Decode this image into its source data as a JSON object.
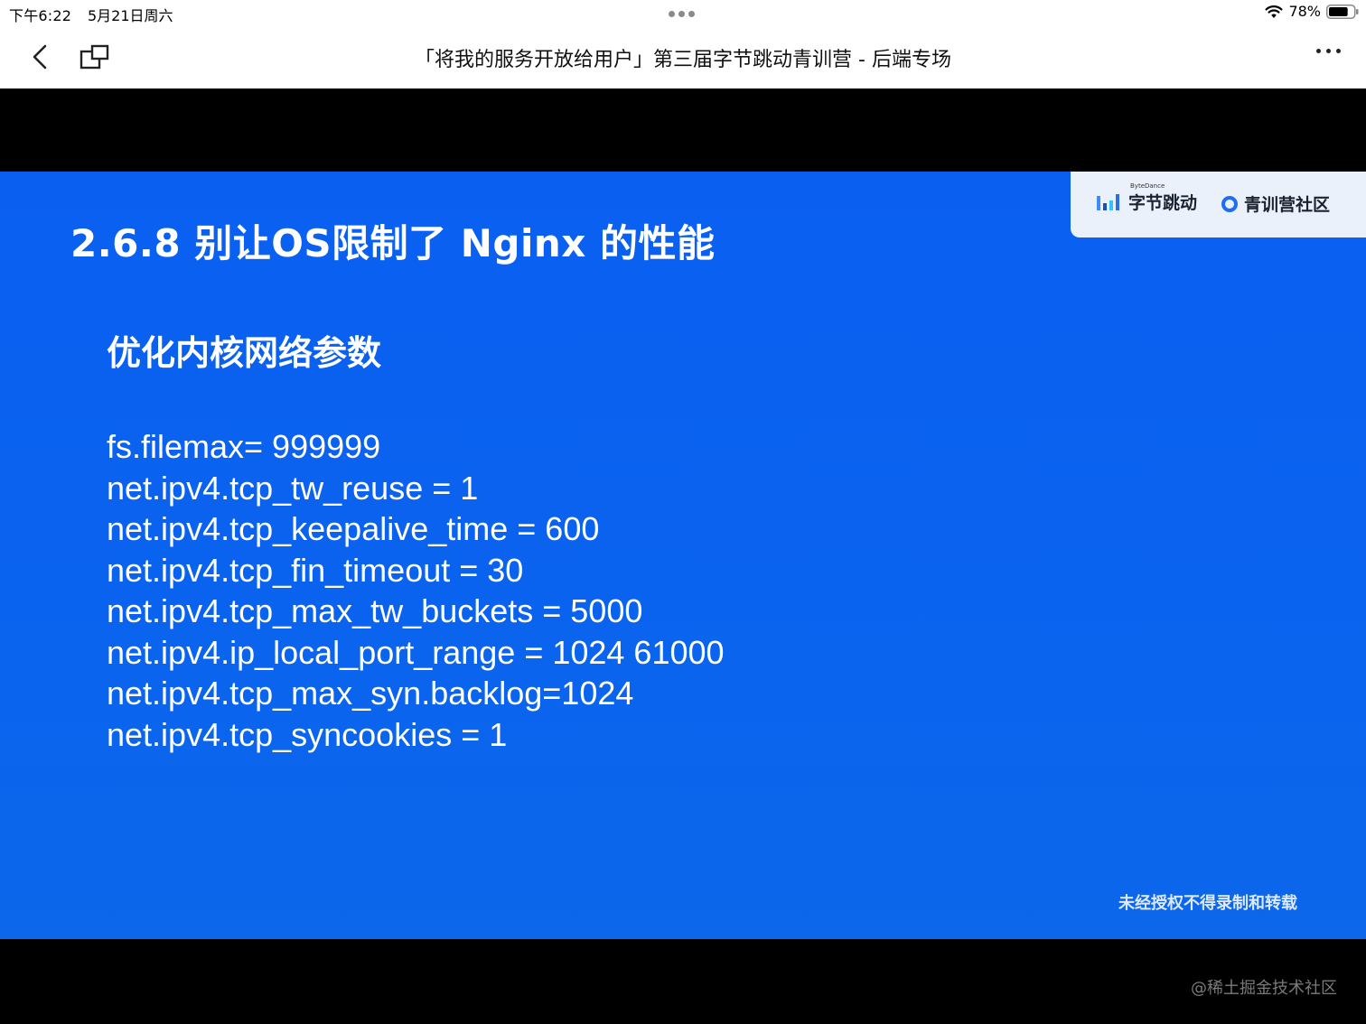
{
  "status_bar": {
    "time": "下午6:22",
    "date": "5月21日周六",
    "battery_percent": "78%",
    "battery_level": 0.78
  },
  "nav": {
    "title": "「将我的服务开放给用户」第三届字节跳动青训营 - 后端专场",
    "back_icon": "chevron-left-icon",
    "window_icon": "window-icon",
    "more_icon": "more-dots-icon"
  },
  "slide": {
    "title": "2.6.8 别让OS限制了 Nginx 的性能",
    "brand": {
      "bytedance_small": "ByteDance",
      "bytedance_name": "字节跳动",
      "camp_name": "青训营社区"
    },
    "heading": "优化内核网络参数",
    "params": [
      "fs.filemax= 999999",
      "net.ipv4.tcp_tw_reuse = 1",
      "net.ipv4.tcp_keepalive_time = 600",
      "net.ipv4.tcp_fin_timeout = 30",
      "net.ipv4.tcp_max_tw_buckets = 5000",
      "net.ipv4.ip_local_port_range = 1024 61000",
      "net.ipv4.tcp_max_syn.backlog=1024",
      "net.ipv4.tcp_syncookies = 1"
    ],
    "copyright": "未经授权不得录制和转载",
    "background_color": "#0a62ef"
  },
  "watermark": "@稀土掘金技术社区"
}
